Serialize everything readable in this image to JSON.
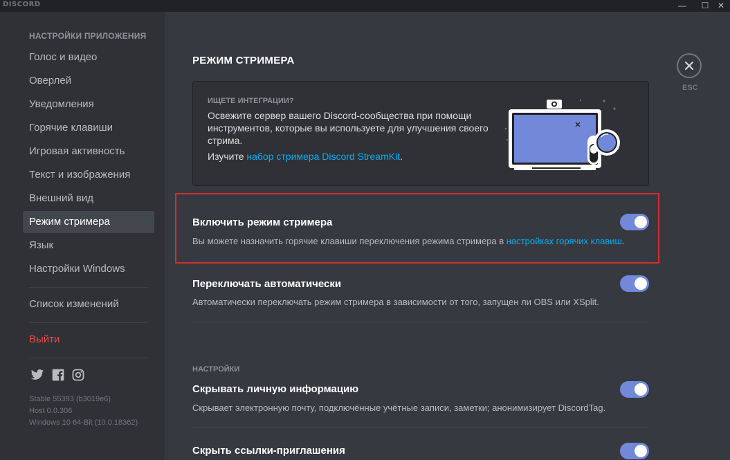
{
  "window": {
    "brand": "DISCORD",
    "minimize_glyph": "—",
    "maximize_glyph": "☐",
    "close_glyph": "✕"
  },
  "sidebar": {
    "header": "НАСТРОЙКИ ПРИЛОЖЕНИЯ",
    "items": [
      {
        "label": "Голос и видео"
      },
      {
        "label": "Оверлей"
      },
      {
        "label": "Уведомления"
      },
      {
        "label": "Горячие клавиши"
      },
      {
        "label": "Игровая активность"
      },
      {
        "label": "Текст и изображения"
      },
      {
        "label": "Внешний вид"
      },
      {
        "label": "Режим стримера"
      },
      {
        "label": "Язык"
      },
      {
        "label": "Настройки Windows"
      }
    ],
    "changelog": "Список изменений",
    "logout": "Выйти",
    "social": [
      "twitter-icon",
      "facebook-icon",
      "instagram-icon"
    ],
    "version": [
      "Stable 55393 (b3019e6)",
      "Host 0.0.306",
      "Windows 10 64-Bit (10.0.18362)"
    ]
  },
  "main": {
    "title": "РЕЖИМ СТРИМЕРА",
    "promo": {
      "eyebrow": "ИЩЕТЕ ИНТЕГРАЦИИ?",
      "text": "Освежите сервер вашего Discord-сообщества при помощи инструментов, которые вы используете для улучшения своего стрима.",
      "link_prefix": "Изучите ",
      "link_text": "набор стримера Discord StreamKit",
      "link_suffix": "."
    },
    "settings": [
      {
        "title": "Включить режим стримера",
        "desc_prefix": "Вы можете назначить горячие клавиши переключения режима стримера в ",
        "desc_link": "настройках горячих клавиш",
        "desc_suffix": ".",
        "enabled": true
      },
      {
        "title": "Переключать автоматически",
        "desc": "Автоматически переключать режим стримера в зависимости от того, запущен ли OBS или XSplit.",
        "enabled": true
      }
    ],
    "section_label": "НАСТРОЙКИ",
    "options": [
      {
        "title": "Скрывать личную информацию",
        "desc": "Скрывает электронную почту, подключённые учётные записи, заметки; анонимизирует DiscordTag.",
        "enabled": true
      },
      {
        "title": "Скрыть ссылки-приглашения",
        "enabled": true
      }
    ],
    "esc_label": "ESC"
  },
  "colors": {
    "accent": "#7289da",
    "link": "#00b0f4",
    "danger": "#f04747",
    "highlight_border": "#d32f2f"
  }
}
